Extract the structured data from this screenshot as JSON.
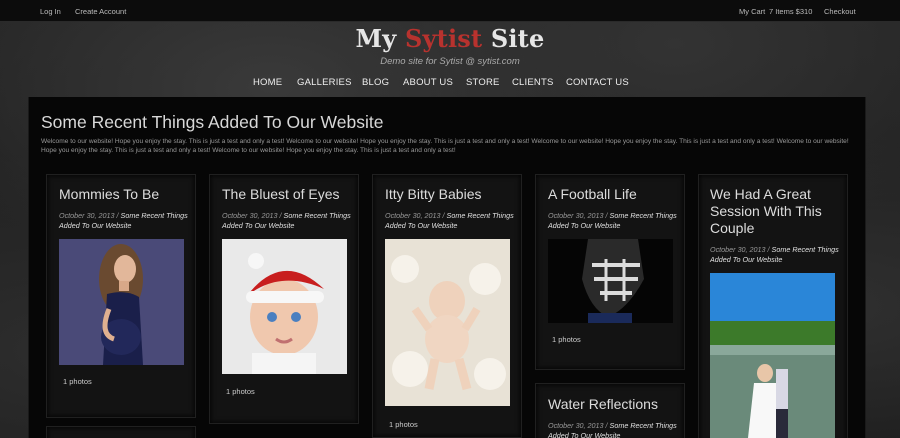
{
  "topbar": {
    "login": "Log In",
    "create_account": "Create Account",
    "cart": "My Cart",
    "items": "7 Items $310",
    "checkout": "Checkout"
  },
  "brand": {
    "part1": "My ",
    "part2": "Sytist",
    "part3": " Site",
    "tagline": "Demo site for Sytist @ sytist.com",
    "accent": "#b8322e"
  },
  "nav": [
    "HOME",
    "GALLERIES",
    "BLOG",
    "ABOUT US",
    "STORE",
    "CLIENTS",
    "CONTACT US"
  ],
  "heading": "Some Recent Things Added To Our Website",
  "intro": "Welcome to our website! Hope you enjoy the stay. This is just a test and only a test! Welcome to our website! Hope you enjoy the stay. This is just a test and only a test! Welcome to our website! Hope you enjoy the stay. This is just a test and only a test! Welcome to our website! Hope you enjoy the stay. This is just a test and only a test! Welcome to our website! Hope you enjoy the stay. This is just a test and only a test!",
  "cards": [
    {
      "title": "Mommies To Be",
      "date": "October 30, 2013",
      "category": "Some Recent Things Added To Our Website",
      "count": "1 photos"
    },
    {
      "title": "The Bluest of Eyes",
      "date": "October 30, 2013",
      "category": "Some Recent Things Added To Our Website",
      "count": "1 photos"
    },
    {
      "title": "Itty Bitty Babies",
      "date": "October 30, 2013",
      "category": "Some Recent Things Added To Our Website",
      "count": "1 photos"
    },
    {
      "title": "A Football Life",
      "date": "October 30, 2013",
      "category": "Some Recent Things Added To Our Website",
      "count": "1 photos"
    },
    {
      "title": "We Had A Great Session With This Couple",
      "date": "October 30, 2013",
      "category": "Some Recent Things Added To Our Website"
    },
    {
      "title": "Water Reflections",
      "date": "October 30, 2013",
      "category": "Some Recent Things Added To Our Website"
    }
  ]
}
